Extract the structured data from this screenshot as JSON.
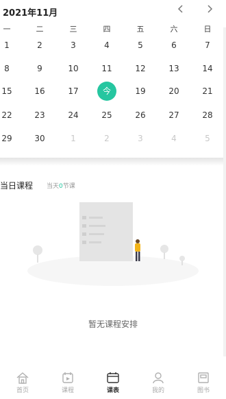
{
  "calendar": {
    "month_title": "2021年11月",
    "prev_icon": "chevron-left-icon",
    "next_icon": "chevron-right-icon",
    "weekdays": [
      "一",
      "二",
      "三",
      "四",
      "五",
      "六",
      "日"
    ],
    "weeks": [
      [
        {
          "d": "1"
        },
        {
          "d": "2"
        },
        {
          "d": "3"
        },
        {
          "d": "4"
        },
        {
          "d": "5"
        },
        {
          "d": "6"
        },
        {
          "d": "7"
        }
      ],
      [
        {
          "d": "8"
        },
        {
          "d": "9"
        },
        {
          "d": "10"
        },
        {
          "d": "11"
        },
        {
          "d": "12"
        },
        {
          "d": "13"
        },
        {
          "d": "14"
        }
      ],
      [
        {
          "d": "15"
        },
        {
          "d": "16"
        },
        {
          "d": "17"
        },
        {
          "d": "今",
          "today": true
        },
        {
          "d": "19"
        },
        {
          "d": "20"
        },
        {
          "d": "21"
        }
      ],
      [
        {
          "d": "22"
        },
        {
          "d": "23"
        },
        {
          "d": "24"
        },
        {
          "d": "25"
        },
        {
          "d": "26"
        },
        {
          "d": "27"
        },
        {
          "d": "28"
        }
      ],
      [
        {
          "d": "29"
        },
        {
          "d": "30"
        },
        {
          "d": "1",
          "other": true
        },
        {
          "d": "2",
          "other": true
        },
        {
          "d": "3",
          "other": true
        },
        {
          "d": "4",
          "other": true
        },
        {
          "d": "5",
          "other": true
        }
      ]
    ],
    "accent_color": "#26c6a0"
  },
  "today_courses": {
    "title": "当日课程",
    "count_prefix": "当天",
    "count": "0",
    "count_suffix": "节课"
  },
  "empty_state": {
    "text": "暂无课程安排"
  },
  "tabbar": {
    "items": [
      {
        "label": "首页",
        "icon": "home-icon"
      },
      {
        "label": "课程",
        "icon": "course-icon"
      },
      {
        "label": "课表",
        "icon": "timetable-icon",
        "active": true
      },
      {
        "label": "我的",
        "icon": "user-icon"
      },
      {
        "label": "图书",
        "icon": "book-icon"
      }
    ]
  }
}
